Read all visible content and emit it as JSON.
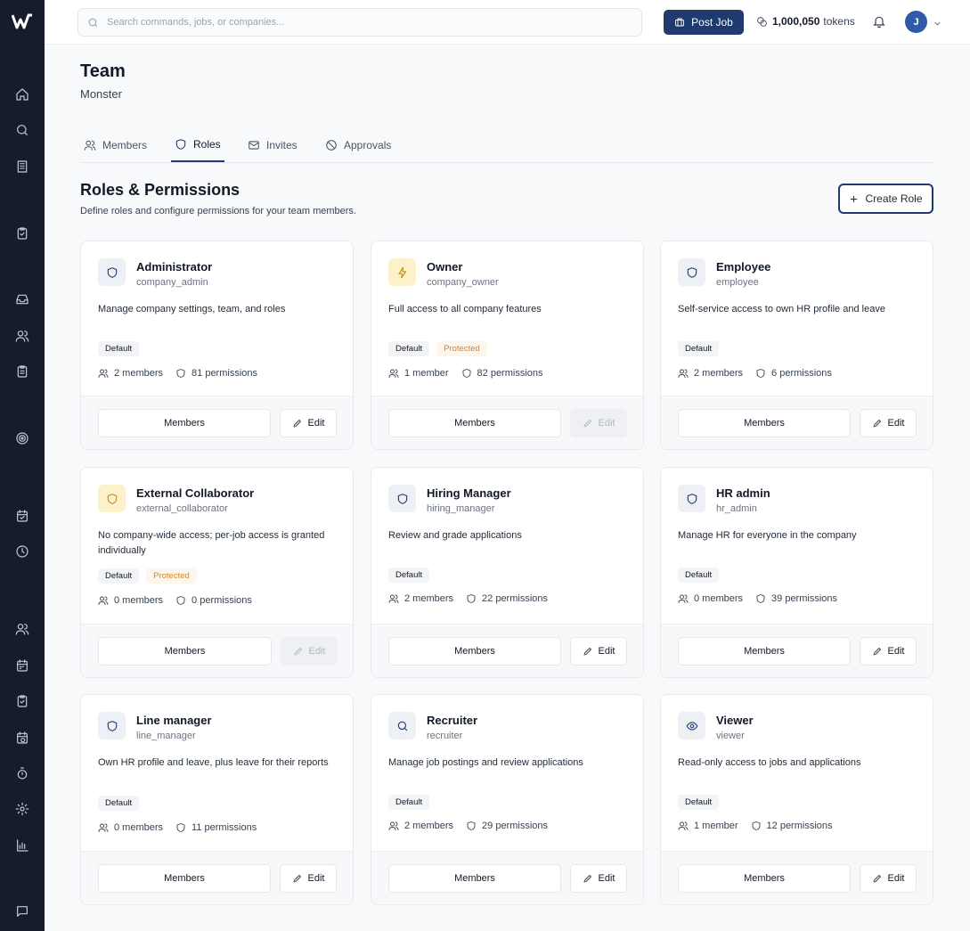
{
  "topbar": {
    "search_placeholder": "Search commands, jobs, or companies...",
    "post_job_label": "Post Job",
    "tokens_value": "1,000,050",
    "tokens_label": "tokens",
    "avatar_initial": "J"
  },
  "sidebar": {
    "icons": [
      "home-icon",
      "search-icon",
      "building-icon",
      "clipboard-check-icon",
      "inbox-icon",
      "users-icon",
      "clipboard-list-icon",
      "target-icon",
      "calendar-icon",
      "clock-icon",
      "team-icon",
      "calendar-days-icon",
      "clipboard-task-icon",
      "calendar-clock-icon",
      "timer-icon",
      "gear-icon",
      "bar-chart-icon",
      "chat-icon"
    ]
  },
  "page": {
    "title": "Team",
    "subtitle": "Monster"
  },
  "tabs": [
    {
      "label": "Members",
      "icon": "users-icon",
      "active": false
    },
    {
      "label": "Roles",
      "icon": "shield-icon",
      "active": true
    },
    {
      "label": "Invites",
      "icon": "mail-icon",
      "active": false
    },
    {
      "label": "Approvals",
      "icon": "ban-icon",
      "active": false
    }
  ],
  "section": {
    "title": "Roles & Permissions",
    "description": "Define roles and configure permissions for your team members.",
    "create_role_label": "Create Role"
  },
  "labels": {
    "members_button": "Members",
    "edit_button": "Edit",
    "default_badge": "Default",
    "protected_badge": "Protected"
  },
  "roles": [
    {
      "name": "Administrator",
      "slug": "company_admin",
      "description": "Manage company settings, team, and roles",
      "icon": "shield-icon",
      "icon_tone": "blue",
      "protected": false,
      "members": "2 members",
      "permissions": "81 permissions",
      "edit_disabled": false
    },
    {
      "name": "Owner",
      "slug": "company_owner",
      "description": "Full access to all company features",
      "icon": "lightning-icon",
      "icon_tone": "amber",
      "protected": true,
      "members": "1 member",
      "permissions": "82 permissions",
      "edit_disabled": true
    },
    {
      "name": "Employee",
      "slug": "employee",
      "description": "Self-service access to own HR profile and leave",
      "icon": "shield-icon",
      "icon_tone": "blue",
      "protected": false,
      "members": "2 members",
      "permissions": "6 permissions",
      "edit_disabled": false
    },
    {
      "name": "External Collaborator",
      "slug": "external_collaborator",
      "description": "No company-wide access; per-job access is granted individually",
      "icon": "shield-icon",
      "icon_tone": "amber",
      "protected": true,
      "members": "0 members",
      "permissions": "0 permissions",
      "edit_disabled": true
    },
    {
      "name": "Hiring Manager",
      "slug": "hiring_manager",
      "description": "Review and grade applications",
      "icon": "shield-icon",
      "icon_tone": "blue",
      "protected": false,
      "members": "2 members",
      "permissions": "22 permissions",
      "edit_disabled": false
    },
    {
      "name": "HR admin",
      "slug": "hr_admin",
      "description": "Manage HR for everyone in the company",
      "icon": "shield-icon",
      "icon_tone": "blue",
      "protected": false,
      "members": "0 members",
      "permissions": "39 permissions",
      "edit_disabled": false
    },
    {
      "name": "Line manager",
      "slug": "line_manager",
      "description": "Own HR profile and leave, plus leave for their reports",
      "icon": "shield-icon",
      "icon_tone": "blue",
      "protected": false,
      "members": "0 members",
      "permissions": "11 permissions",
      "edit_disabled": false
    },
    {
      "name": "Recruiter",
      "slug": "recruiter",
      "description": "Manage job postings and review applications",
      "icon": "search-icon",
      "icon_tone": "blue",
      "protected": false,
      "members": "2 members",
      "permissions": "29 permissions",
      "edit_disabled": false
    },
    {
      "name": "Viewer",
      "slug": "viewer",
      "description": "Read-only access to jobs and applications",
      "icon": "eye-icon",
      "icon_tone": "blue",
      "protected": false,
      "members": "1 member",
      "permissions": "12 permissions",
      "edit_disabled": false
    }
  ],
  "colors": {
    "sidebar_bg": "#141c2e",
    "accent": "#1e3a6e",
    "protected": "#d1852d"
  }
}
